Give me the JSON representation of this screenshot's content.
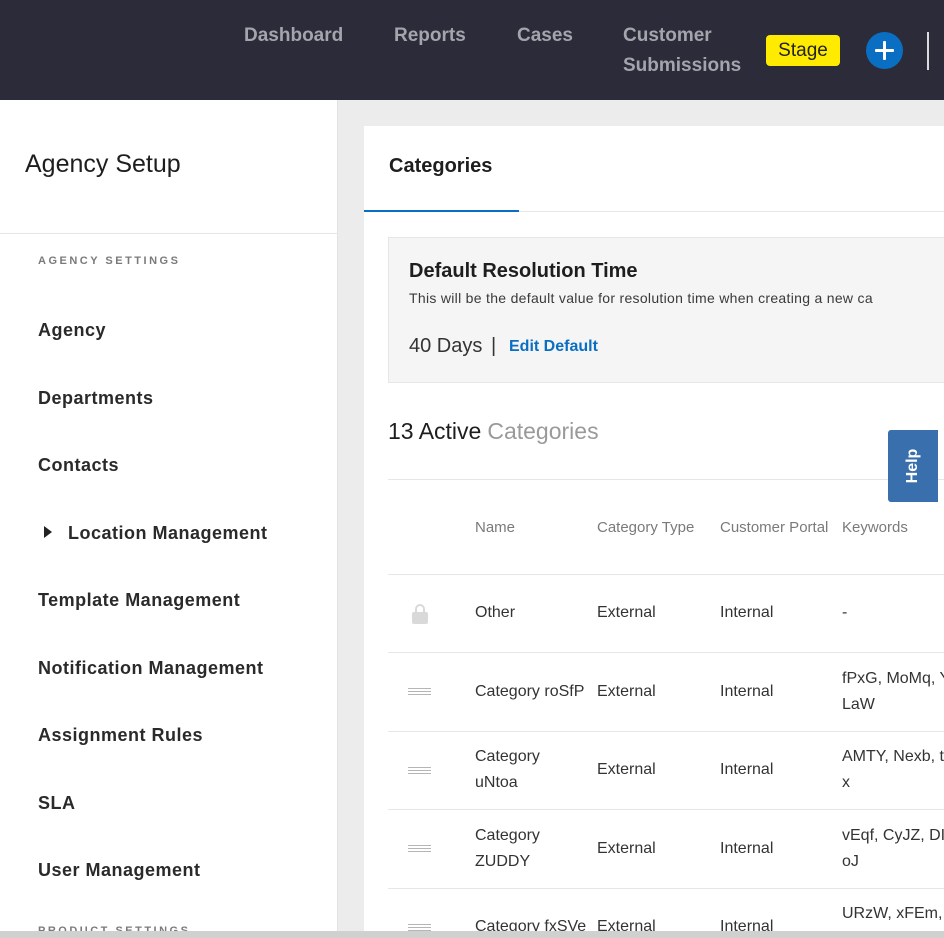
{
  "topbar": {
    "nav": [
      "Dashboard",
      "Reports",
      "Cases",
      "Customer",
      "Submissions"
    ],
    "stage_label": "Stage",
    "stage_color": "#ffeb00",
    "add_icon": "plus-circle-icon",
    "bg_color": "#2b2b39"
  },
  "sidebar": {
    "title": "Agency Setup",
    "section_agency": "AGENCY SETTINGS",
    "items": [
      {
        "label": "Agency"
      },
      {
        "label": "Departments"
      },
      {
        "label": "Contacts"
      },
      {
        "label": "Location Management"
      },
      {
        "label": "Template Management"
      },
      {
        "label": "Notification Management"
      },
      {
        "label": "Assignment Rules"
      },
      {
        "label": "SLA"
      },
      {
        "label": "User Management"
      }
    ],
    "section_product": "PRODUCT SETTINGS"
  },
  "main": {
    "tab_label": "Categories",
    "default_box": {
      "title": "Default Resolution Time",
      "description": "This will be the default value for resolution time when creating a new ca",
      "value": "40 Days",
      "separator": "|",
      "edit_label": "Edit Default"
    },
    "count_num": "13 Active",
    "count_label": "Categories",
    "table": {
      "headers": [
        "Name",
        "Category Type",
        "Customer Portal",
        "Keywords"
      ],
      "rows": [
        {
          "name_1": "Other",
          "name_2": "",
          "type": "External",
          "portal": "Internal",
          "kw_1": "-",
          "kw_2": ""
        },
        {
          "name_1": "Category roSfP",
          "name_2": "",
          "type": "External",
          "portal": "Internal",
          "kw_1": "fPxG, MoMq, Y",
          "kw_2": "LaW"
        },
        {
          "name_1": "Category",
          "name_2": "uNtoa",
          "type": "External",
          "portal": "Internal",
          "kw_1": "AMTY, Nexb, t",
          "kw_2": "x"
        },
        {
          "name_1": "Category",
          "name_2": "ZUDDY",
          "type": "External",
          "portal": "Internal",
          "kw_1": "vEqf, CyJZ, DI",
          "kw_2": "oJ"
        },
        {
          "name_1": "Category fxSVe",
          "name_2": "",
          "type": "External",
          "portal": "Internal",
          "kw_1": "URzW, xFEm,",
          "kw_2": ""
        }
      ]
    }
  },
  "help_label": "Help"
}
